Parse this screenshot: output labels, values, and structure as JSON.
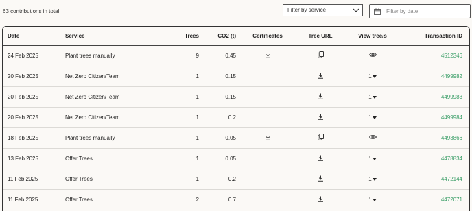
{
  "summary": {
    "count_text": "63 contributions in total"
  },
  "filters": {
    "service_value": "Filter by service",
    "date_placeholder": "Filter by date"
  },
  "table": {
    "headers": {
      "date": "Date",
      "service": "Service",
      "trees": "Trees",
      "co2": "CO2 (t)",
      "certificates": "Certificates",
      "tree_url": "Tree URL",
      "view": "View tree/s",
      "txn": "Transaction ID"
    },
    "rows": [
      {
        "date": "24 Feb 2025",
        "service": "Plant trees manually",
        "trees": "9",
        "co2": "0.45",
        "certificate": true,
        "url_icon": "copy-icon",
        "view": "eye",
        "view_count": "",
        "txn": "4512346"
      },
      {
        "date": "20 Feb 2025",
        "service": "Net Zero Citizen/Team",
        "trees": "1",
        "co2": "0.15",
        "certificate": false,
        "url_icon": "download-icon",
        "view": "dropdown",
        "view_count": "1",
        "txn": "4499982"
      },
      {
        "date": "20 Feb 2025",
        "service": "Net Zero Citizen/Team",
        "trees": "1",
        "co2": "0.15",
        "certificate": false,
        "url_icon": "download-icon",
        "view": "dropdown",
        "view_count": "1",
        "txn": "4499983"
      },
      {
        "date": "20 Feb 2025",
        "service": "Net Zero Citizen/Team",
        "trees": "1",
        "co2": "0.2",
        "certificate": false,
        "url_icon": "download-icon",
        "view": "dropdown",
        "view_count": "1",
        "txn": "4499984"
      },
      {
        "date": "18 Feb 2025",
        "service": "Plant trees manually",
        "trees": "1",
        "co2": "0.05",
        "certificate": true,
        "url_icon": "copy-icon",
        "view": "eye",
        "view_count": "",
        "txn": "4493866"
      },
      {
        "date": "13 Feb 2025",
        "service": "Offer Trees",
        "trees": "1",
        "co2": "0.05",
        "certificate": false,
        "url_icon": "download-icon",
        "view": "dropdown",
        "view_count": "1",
        "txn": "4478834"
      },
      {
        "date": "11 Feb 2025",
        "service": "Offer Trees",
        "trees": "1",
        "co2": "0.2",
        "certificate": false,
        "url_icon": "download-icon",
        "view": "dropdown",
        "view_count": "1",
        "txn": "4472144"
      },
      {
        "date": "11 Feb 2025",
        "service": "Offer Trees",
        "trees": "2",
        "co2": "0.7",
        "certificate": false,
        "url_icon": "download-icon",
        "view": "dropdown",
        "view_count": "1",
        "txn": "4472071"
      }
    ]
  }
}
